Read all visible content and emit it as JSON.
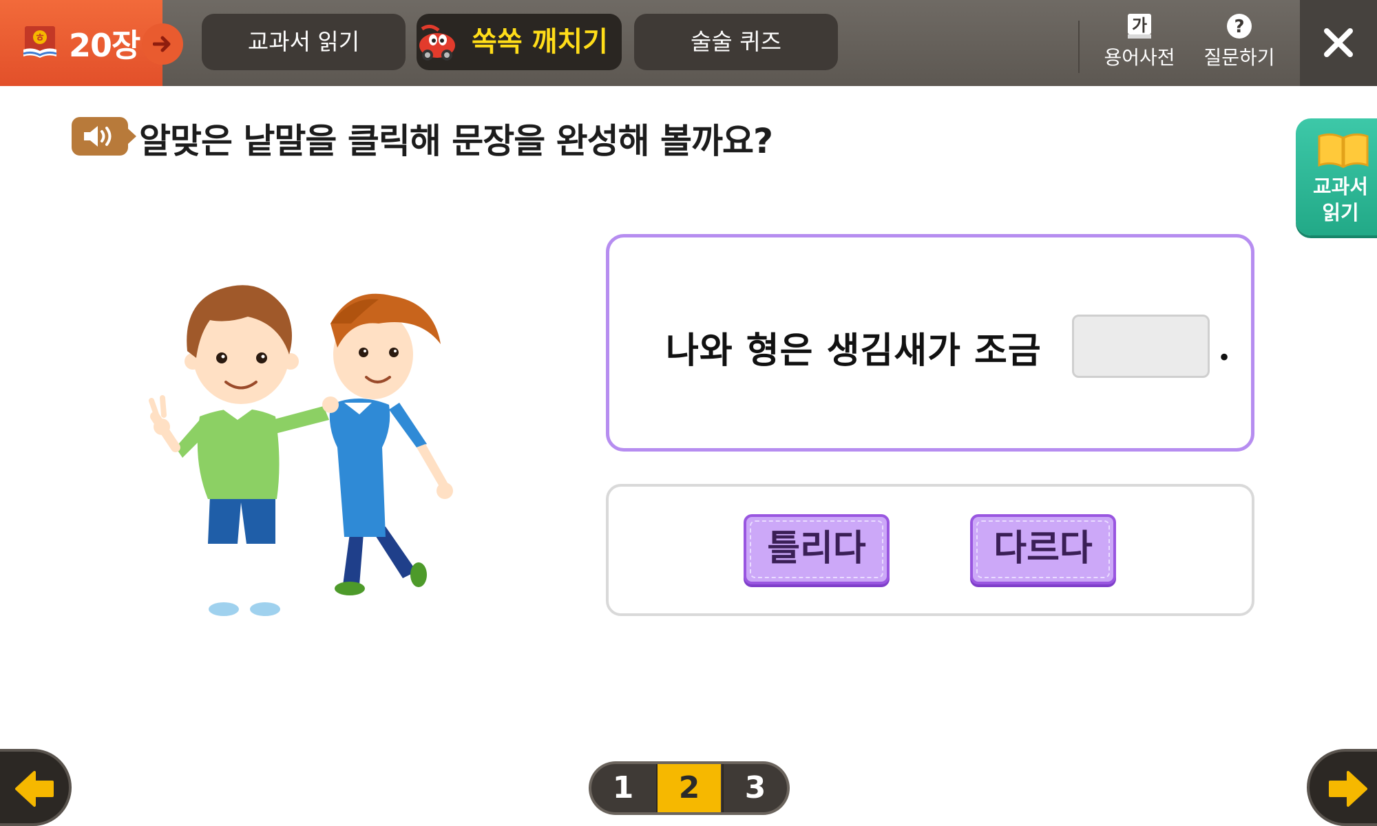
{
  "header": {
    "chapter_label": "20장",
    "tabs": [
      {
        "label": "교과서 읽기"
      },
      {
        "label": "쏙쏙 깨치기",
        "active": true
      },
      {
        "label": "술술 퀴즈"
      }
    ],
    "tools": {
      "dictionary_icon_text": "가",
      "dictionary_label": "용어사전",
      "question_icon_text": "?",
      "question_label": "질문하기"
    }
  },
  "side_tab": {
    "label_line1": "교과서",
    "label_line2": "읽기"
  },
  "main": {
    "instruction": "알맞은 낱말을 클릭해 문장을 완성해 볼까요?",
    "sentence": "나와 형은 생김새가 조금",
    "sentence_end": ".",
    "choices": [
      {
        "label": "틀리다"
      },
      {
        "label": "다르다"
      }
    ]
  },
  "pagination": {
    "pages": [
      "1",
      "2",
      "3"
    ],
    "current": "2"
  },
  "colors": {
    "chapter_bg": "#e95b2f",
    "active_tab_text": "#ffdd19",
    "sentence_border": "#b68df0",
    "choice_bg": "#cca8f8",
    "side_tab": "#2bb898",
    "current_page": "#f6b800"
  },
  "icons": [
    "book-logo-icon",
    "arrow-right-icon",
    "car-mascot-icon",
    "dictionary-icon",
    "question-icon",
    "close-icon",
    "speaker-icon",
    "book-icon",
    "arrow-left-icon"
  ]
}
